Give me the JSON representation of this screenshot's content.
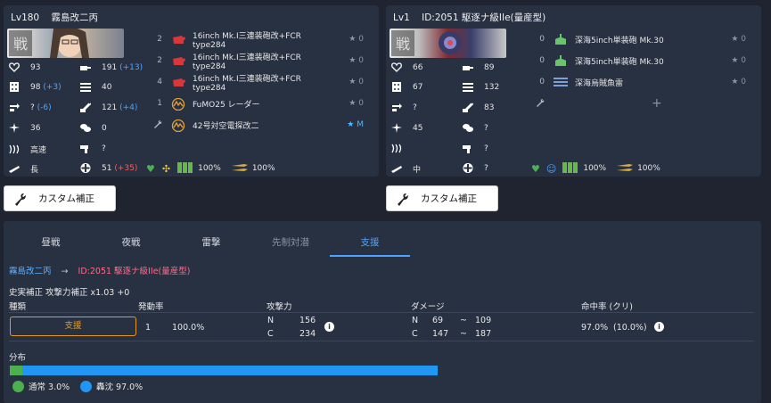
{
  "left_ship": {
    "level": "Lv180",
    "name": "霧島改二丙",
    "stats": {
      "hp": "93",
      "firepower": "191",
      "firepower_bonus": "(+13)",
      "armor": "98",
      "armor_bonus": "(+3)",
      "torpedo": "40",
      "evasion": "?",
      "evasion_bonus": "(-6)",
      "aa": "121",
      "aa_bonus": "(+4)",
      "aircraft": "36",
      "asw": "0",
      "speed": "高速",
      "los": "?",
      "range": "長",
      "luck": "51",
      "luck_bonus": "(+35)"
    },
    "equipment": [
      {
        "slot": "2",
        "name": "16inch Mk.I三連装砲改+FCR type284",
        "star": "★ 0",
        "icon": "red-gun-icon"
      },
      {
        "slot": "2",
        "name": "16inch Mk.I三連装砲改+FCR type284",
        "star": "★ 0",
        "icon": "red-gun-icon"
      },
      {
        "slot": "4",
        "name": "16inch Mk.I三連装砲改+FCR type284",
        "star": "★ 0",
        "icon": "red-gun-icon"
      },
      {
        "slot": "1",
        "name": "FuMO25 レーダー",
        "star": "★ 0",
        "icon": "radar-icon"
      },
      {
        "slot": "",
        "name": "42号対空電探改二",
        "star": "★ M",
        "icon": "radar-icon"
      }
    ],
    "supply_fuel": "100%",
    "supply_ammo": "100%"
  },
  "right_ship": {
    "level": "Lv1",
    "name": "ID:2051 駆逐ナ級IIe(量産型)",
    "stats": {
      "hp": "66",
      "firepower": "89",
      "armor": "67",
      "torpedo": "132",
      "evasion": "?",
      "aa": "83",
      "aircraft": "45",
      "asw": "?",
      "speed": "))) ",
      "los": "?",
      "range": "中",
      "luck": "?"
    },
    "equipment": [
      {
        "slot": "0",
        "name": "深海5inch単装砲 Mk.30",
        "star": "★ 0",
        "icon": "green-gun-icon"
      },
      {
        "slot": "0",
        "name": "深海5inch単装砲 Mk.30",
        "star": "★ 0",
        "icon": "green-gun-icon"
      },
      {
        "slot": "0",
        "name": "深海烏賊魚雷",
        "star": "★ 0",
        "icon": "torpedo-icon"
      }
    ],
    "supply_fuel": "100%",
    "supply_ammo": "100%"
  },
  "buttons": {
    "custom_left": "カスタム補正",
    "custom_right": "カスタム補正"
  },
  "tabs": [
    "昼戦",
    "夜戦",
    "雷撃",
    "先制対潜",
    "支援"
  ],
  "detail": {
    "attacker": "霧島改二丙",
    "arrow": "→",
    "defender": "ID:2051 駆逐ナ級IIe(量産型)",
    "correction": "史実補正 攻撃力補正 x1.03 +0",
    "headers": {
      "type": "種類",
      "rate": "発動率",
      "power": "攻撃力",
      "damage": "ダメージ",
      "hit": "命中率 (クリ)"
    },
    "row": {
      "type": "支援",
      "count": "1",
      "rate": "100.0%",
      "power_n_label": "N",
      "power_n": "156",
      "power_c_label": "C",
      "power_c": "234",
      "dmg_n_label": "N",
      "dmg_n_min": "69",
      "dmg_n_tilde": "~",
      "dmg_n_max": "109",
      "dmg_c_label": "C",
      "dmg_c_min": "147",
      "dmg_c_tilde": "~",
      "dmg_c_max": "187",
      "hit": "97.0%",
      "crit": "(10.0%)"
    },
    "distribution_label": "分布",
    "distribution": {
      "normal_label": "通常 3.0%",
      "normal_fraction": 0.03,
      "sink_label": "轟沈 97.0%",
      "sink_fraction": 0.97
    }
  },
  "colors": {
    "accent": "#4da3ff",
    "normal": "#4caf50",
    "sink": "#2196f3",
    "support_border": "#e59a1f",
    "enemy_name": "#ff6b8a"
  }
}
